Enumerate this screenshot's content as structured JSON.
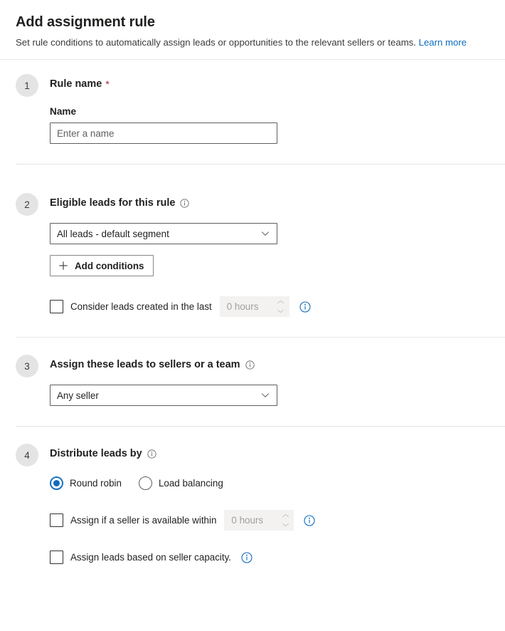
{
  "header": {
    "title": "Add assignment rule",
    "subtitle": "Set rule conditions to automatically assign leads or opportunities to the relevant sellers or teams.",
    "learn_more": "Learn more"
  },
  "colors": {
    "accent": "#0f6cbd",
    "link": "#0f6cbd",
    "required_star": "#a4262c",
    "badge_bg": "#e4e4e4",
    "divider": "#e6e6e6",
    "disabled_bg": "#f3f2f1",
    "disabled_text": "#a19f9d",
    "text": "#201f1e"
  },
  "sections": [
    {
      "number": "1",
      "title": "Rule name",
      "required_marker": "*",
      "field_label": "Name",
      "input_placeholder": "Enter a name",
      "input_value": ""
    },
    {
      "number": "2",
      "title": "Eligible leads for this rule",
      "info_icon": "info-circle-icon",
      "dropdown_value": "All leads - default segment",
      "dropdown_icon": "chevron-down-icon",
      "add_conditions_label": "Add conditions",
      "add_conditions_icon": "plus-icon",
      "checkbox": {
        "label": "Consider leads created in the last",
        "checked": false,
        "spinner_value": "0 hours",
        "spinner_up_icon": "chevron-up-icon",
        "spinner_down_icon": "chevron-down-icon",
        "spinner_disabled": true,
        "info_icon": "info-circle-icon"
      }
    },
    {
      "number": "3",
      "title": "Assign these leads to sellers or a team",
      "info_icon": "info-circle-icon",
      "dropdown_value": "Any seller",
      "dropdown_icon": "chevron-down-icon"
    },
    {
      "number": "4",
      "title": "Distribute leads by",
      "info_icon": "info-circle-icon",
      "radios": [
        {
          "label": "Round robin",
          "checked": true
        },
        {
          "label": "Load balancing",
          "checked": false
        }
      ],
      "checkbox_available": {
        "label": "Assign if a seller is available within",
        "checked": false,
        "spinner_value": "0 hours",
        "spinner_disabled": true,
        "info_icon": "info-circle-icon"
      },
      "checkbox_capacity": {
        "label": "Assign leads based on seller capacity.",
        "checked": false,
        "info_icon": "info-circle-icon"
      }
    }
  ]
}
